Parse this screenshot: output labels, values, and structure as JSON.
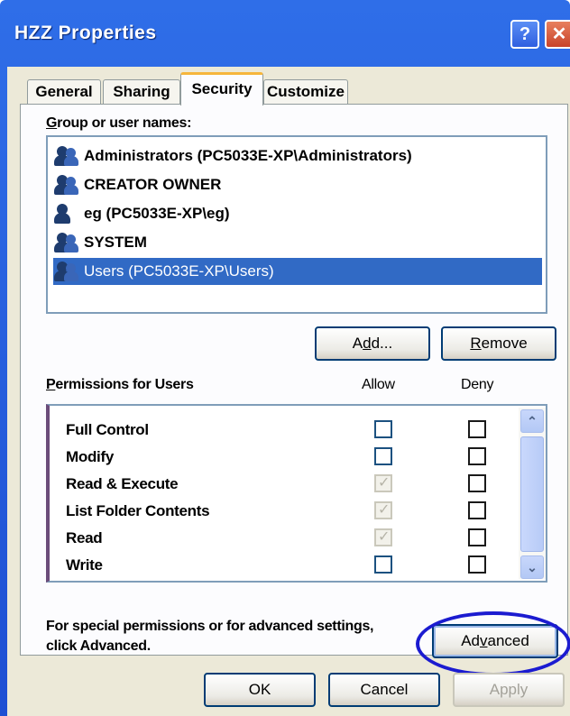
{
  "window": {
    "title": "HZZ Properties",
    "help_glyph": "?",
    "close_glyph": "✕"
  },
  "tabs": [
    {
      "label": "General"
    },
    {
      "label": "Sharing"
    },
    {
      "label": "Security"
    },
    {
      "label": "Customize"
    }
  ],
  "security": {
    "group_label_pre": "",
    "group_label_ul": "G",
    "group_label_post": "roup or user names:",
    "users": [
      {
        "name": "Administrators (PC5033E-XP\\Administrators)"
      },
      {
        "name": "CREATOR OWNER"
      },
      {
        "name": "eg (PC5033E-XP\\eg)"
      },
      {
        "name": "SYSTEM"
      },
      {
        "name": "Users (PC5033E-XP\\Users)",
        "selected": true
      }
    ],
    "add_label_pre": "A",
    "add_label_ul": "d",
    "add_label_post": "d...",
    "remove_label_ul": "R",
    "remove_label_post": "emove",
    "perm_label_ul": "P",
    "perm_label_post": "ermissions for Users",
    "allow_header": "Allow",
    "deny_header": "Deny",
    "permissions": [
      {
        "name": "Full Control",
        "allow": false,
        "allow_inherited": false,
        "deny": false
      },
      {
        "name": "Modify",
        "allow": false,
        "allow_inherited": false,
        "deny": false
      },
      {
        "name": "Read & Execute",
        "allow": true,
        "allow_inherited": true,
        "deny": false
      },
      {
        "name": "List Folder Contents",
        "allow": true,
        "allow_inherited": true,
        "deny": false
      },
      {
        "name": "Read",
        "allow": true,
        "allow_inherited": true,
        "deny": false
      },
      {
        "name": "Write",
        "allow": false,
        "allow_inherited": false,
        "deny": false
      }
    ],
    "advanced_text_line1": "For special permissions or for advanced settings,",
    "advanced_text_line2": "click Advanced.",
    "advanced_label_pre": "Ad",
    "advanced_label_ul": "v",
    "advanced_label_post": "anced",
    "scroll_up_glyph": "⌃",
    "scroll_down_glyph": "⌄"
  },
  "footer": {
    "ok_label": "OK",
    "cancel_label": "Cancel",
    "apply_label": "Apply"
  },
  "colors": {
    "titlebar": "#2f6ee8",
    "selection": "#316ac5",
    "tab_accent": "#f6b63c",
    "annotation_circle": "#1b1bd0"
  }
}
